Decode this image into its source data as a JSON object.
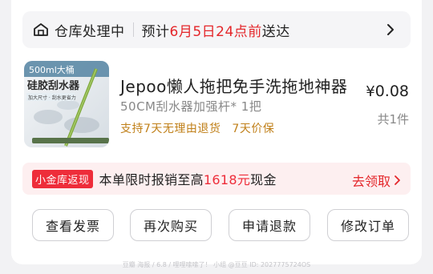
{
  "status_bar": {
    "title": "仓库处理中",
    "eta_prefix": "预计",
    "eta_date": "6月5日24点前",
    "eta_suffix": "送达",
    "icons": {
      "left": "warehouse-icon",
      "right": "chevron-right-icon"
    }
  },
  "product": {
    "image_labels": [
      "500ml大桶",
      "硅胶刮水器",
      "加大尺寸 · 刮水更省力"
    ],
    "name": "Jepoo懒人拖把免手洗拖地神器",
    "spec": "50CM刮水器加强杆* 1把",
    "promises": [
      "支持7天无理由退货",
      "7天价保"
    ],
    "price_symbol": "¥",
    "price": "0.08",
    "quantity": "共1件"
  },
  "rebate": {
    "badge": "小金库返现",
    "text_prefix": "本单限时报销至高",
    "amount": "1618元",
    "text_suffix": "现金",
    "action": "去领取",
    "colors": {
      "accent": "#ee2d3a",
      "background": "#fdeff0"
    }
  },
  "actions": [
    "查看发票",
    "再次购买",
    "申请退款",
    "修改订单"
  ],
  "footer": "豆瓣 海报 / 6.8 / 哩哩嗦嗦了！ 小组 @豆豆 ID: 2027775724OS"
}
